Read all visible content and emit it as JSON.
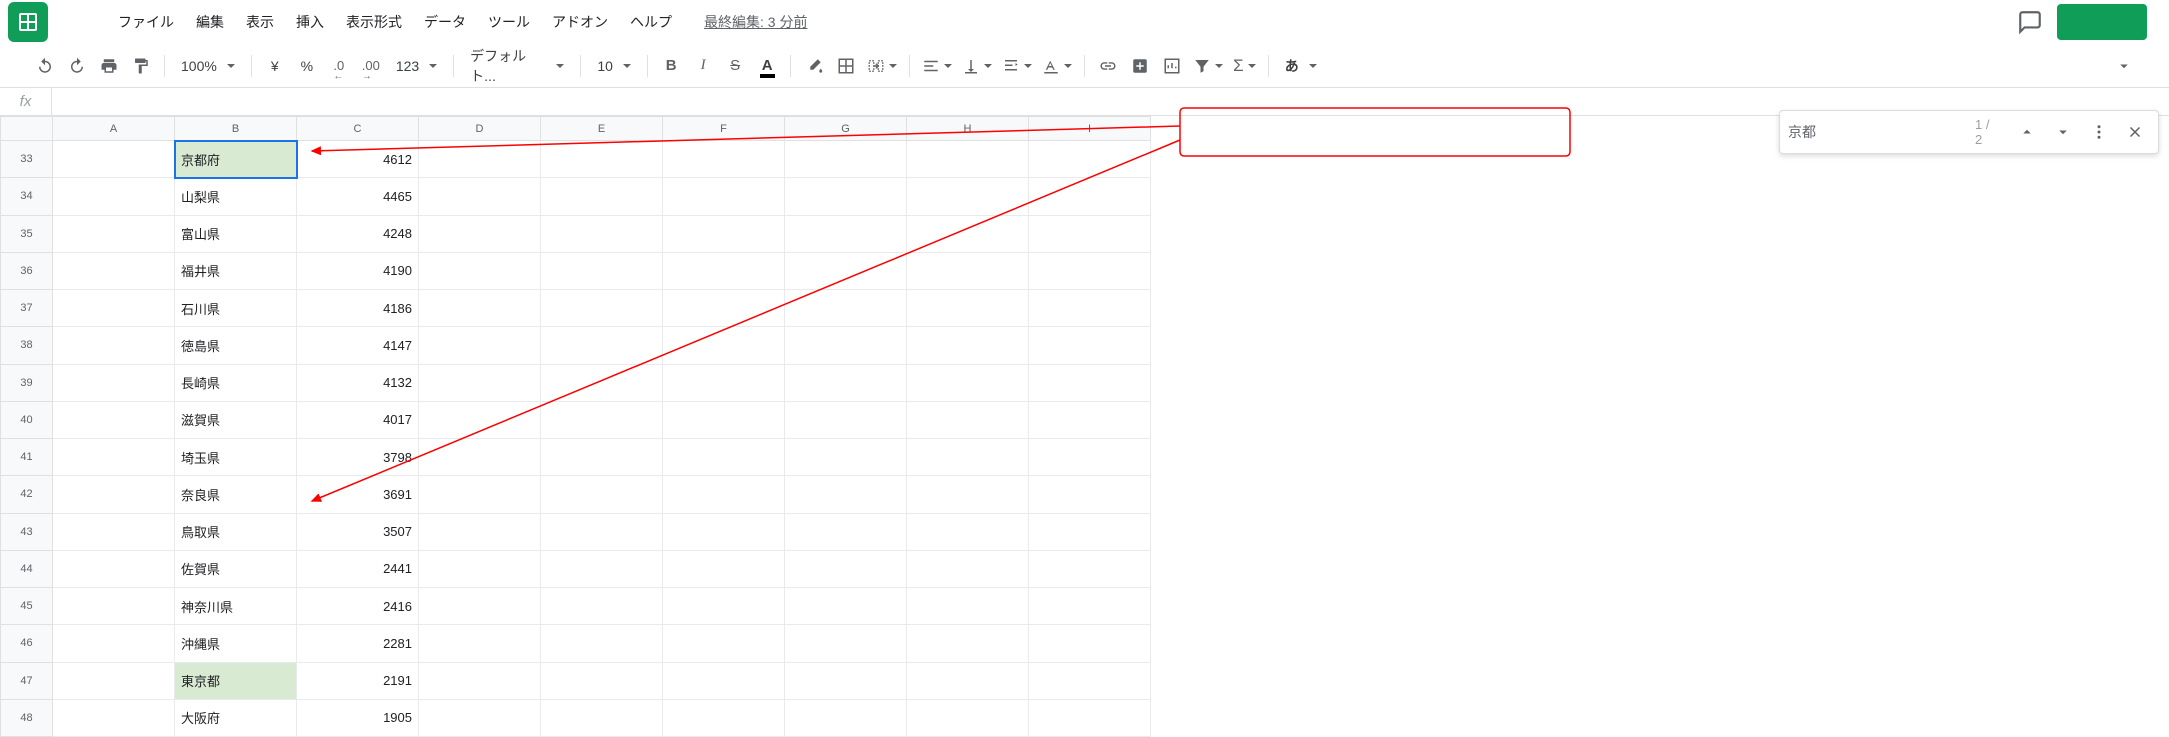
{
  "menus": {
    "file": "ファイル",
    "edit": "編集",
    "view": "表示",
    "insert": "挿入",
    "format": "表示形式",
    "data": "データ",
    "tools": "ツール",
    "addons": "アドオン",
    "help": "ヘルプ"
  },
  "last_edit": "最終編集: 3 分前",
  "toolbar": {
    "zoom": "100%",
    "currency": "¥",
    "percent": "%",
    "dec_dec": ".0",
    "dec_inc": ".00",
    "num_format": "123",
    "font": "デフォルト...",
    "font_size": "10",
    "input_mode": "あ"
  },
  "formula_bar": {
    "fx": "fx",
    "value": ""
  },
  "columns": [
    "A",
    "B",
    "C",
    "D",
    "E",
    "F",
    "G",
    "H",
    "I"
  ],
  "rows": [
    {
      "n": 33,
      "b": "京都府",
      "c": 4612,
      "active": true
    },
    {
      "n": 34,
      "b": "山梨県",
      "c": 4465
    },
    {
      "n": 35,
      "b": "富山県",
      "c": 4248
    },
    {
      "n": 36,
      "b": "福井県",
      "c": 4190
    },
    {
      "n": 37,
      "b": "石川県",
      "c": 4186
    },
    {
      "n": 38,
      "b": "徳島県",
      "c": 4147
    },
    {
      "n": 39,
      "b": "長崎県",
      "c": 4132
    },
    {
      "n": 40,
      "b": "滋賀県",
      "c": 4017
    },
    {
      "n": 41,
      "b": "埼玉県",
      "c": 3798
    },
    {
      "n": 42,
      "b": "奈良県",
      "c": 3691
    },
    {
      "n": 43,
      "b": "鳥取県",
      "c": 3507
    },
    {
      "n": 44,
      "b": "佐賀県",
      "c": 2441
    },
    {
      "n": 45,
      "b": "神奈川県",
      "c": 2416
    },
    {
      "n": 46,
      "b": "沖縄県",
      "c": 2281
    },
    {
      "n": 47,
      "b": "東京都",
      "c": 2191,
      "match": true
    },
    {
      "n": 48,
      "b": "大阪府",
      "c": 1905
    }
  ],
  "find": {
    "value": "京都",
    "count": "1 / 2"
  }
}
